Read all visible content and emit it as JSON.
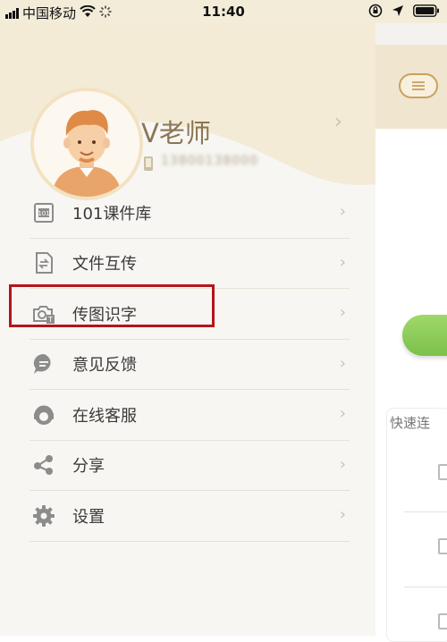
{
  "status_bar": {
    "carrier": "中国移动",
    "time": "11:40"
  },
  "profile": {
    "name": "V老师",
    "phone": "13800138000"
  },
  "menu": {
    "items": [
      {
        "label": "101课件库",
        "icon": "courseware-library-icon"
      },
      {
        "label": "文件互传",
        "icon": "file-transfer-icon"
      },
      {
        "label": "传图识字",
        "icon": "photo-ocr-icon"
      },
      {
        "label": "意见反馈",
        "icon": "feedback-icon"
      },
      {
        "label": "在线客服",
        "icon": "customer-service-icon"
      },
      {
        "label": "分享",
        "icon": "share-icon"
      },
      {
        "label": "设置",
        "icon": "settings-gear-icon"
      }
    ]
  },
  "background_screen": {
    "quick_connect_label": "快速连"
  },
  "colors": {
    "highlight": "#b3151b",
    "header_beige": "#f3ecd9",
    "accent_green": "#7cc04a",
    "icon_gray": "#8c8c8c"
  }
}
